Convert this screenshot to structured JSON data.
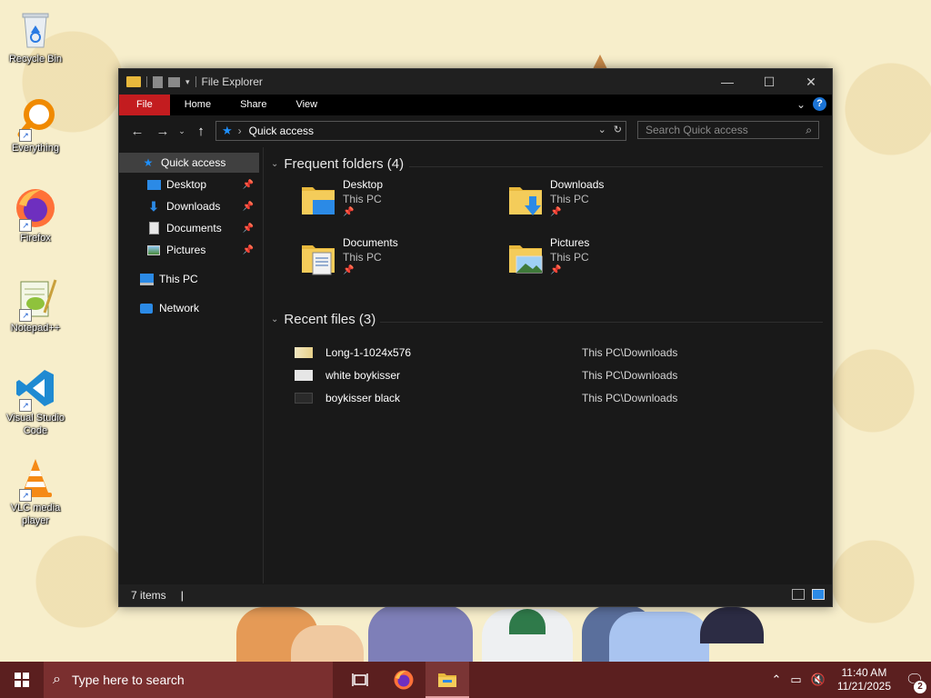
{
  "desktop": {
    "icons": [
      {
        "label": "Recycle Bin",
        "icon": "recycle-bin-icon"
      },
      {
        "label": "Everything",
        "icon": "everything-search-icon"
      },
      {
        "label": "Firefox",
        "icon": "firefox-icon"
      },
      {
        "label": "Notepad++",
        "icon": "notepad-plus-plus-icon"
      },
      {
        "label": "Visual Studio Code",
        "icon": "vscode-icon"
      },
      {
        "label": "VLC media player",
        "icon": "vlc-icon"
      }
    ]
  },
  "explorer": {
    "title": "File Explorer",
    "ribbon_tabs": [
      "File",
      "Home",
      "Share",
      "View"
    ],
    "address": {
      "location": "Quick access"
    },
    "search": {
      "placeholder": "Search Quick access"
    },
    "nav_pane": {
      "quick_access": "Quick access",
      "pinned": [
        "Desktop",
        "Downloads",
        "Documents",
        "Pictures"
      ],
      "this_pc": "This PC",
      "network": "Network"
    },
    "frequent": {
      "header": "Frequent folders (4)",
      "folders": [
        {
          "name": "Desktop",
          "location": "This PC",
          "pinned": true
        },
        {
          "name": "Downloads",
          "location": "This PC",
          "pinned": true
        },
        {
          "name": "Documents",
          "location": "This PC",
          "pinned": true
        },
        {
          "name": "Pictures",
          "location": "This PC",
          "pinned": true
        }
      ]
    },
    "recent": {
      "header": "Recent files (3)",
      "files": [
        {
          "name": "Long-1-1024x576",
          "path": "This PC\\Downloads"
        },
        {
          "name": "white boykisser",
          "path": "This PC\\Downloads"
        },
        {
          "name": "boykisser black",
          "path": "This PC\\Downloads"
        }
      ]
    },
    "status": {
      "items": "7 items"
    }
  },
  "taskbar": {
    "search_placeholder": "Type here to search",
    "apps": [
      "task-view-icon",
      "firefox-icon",
      "file-explorer-icon"
    ],
    "clock": {
      "time": "11:40 AM",
      "date": "11/21/2025"
    },
    "notification_count": "2"
  },
  "colors": {
    "taskbar": "#5b1f1f",
    "file_tab": "#c31c1f",
    "accent_blue": "#1e90ff",
    "window_bg": "#191919"
  }
}
